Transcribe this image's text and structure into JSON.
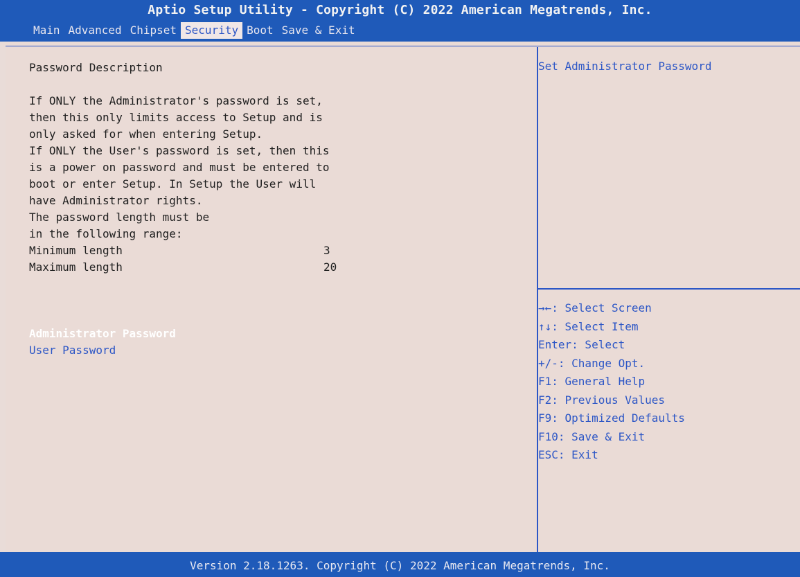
{
  "header": {
    "title": "Aptio Setup Utility - Copyright (C) 2022 American Megatrends, Inc.",
    "tabs": [
      "Main",
      "Advanced",
      "Chipset",
      "Security",
      "Boot",
      "Save & Exit"
    ],
    "active_tab": "Security"
  },
  "left": {
    "heading": "Password Description",
    "paragraph": [
      "If ONLY the Administrator's password is set,",
      "then this only limits access to Setup and is",
      "only asked for when entering Setup.",
      "If ONLY the User's password is set, then this",
      "is a power on password and must be entered to",
      "boot or enter Setup. In Setup the User will",
      "have Administrator rights.",
      "The password length must be",
      "in the following range:"
    ],
    "min_label": "Minimum length",
    "min_value": "3",
    "max_label": "Maximum length",
    "max_value": "20",
    "menu": [
      {
        "label": "Administrator Password"
      },
      {
        "label": "User Password"
      }
    ]
  },
  "right": {
    "help": "Set Administrator Password",
    "keys": [
      "→←: Select Screen",
      "↑↓: Select Item",
      "Enter: Select",
      "+/-: Change Opt.",
      "F1: General Help",
      "F2: Previous Values",
      "F9: Optimized Defaults",
      "F10: Save & Exit",
      "ESC: Exit"
    ]
  },
  "footer": {
    "version": "Version 2.18.1263. Copyright (C) 2022 American Megatrends, Inc."
  },
  "colors": {
    "bar_blue": "#1f5ab9",
    "text_blue": "#2c56c6",
    "background": "#e9dcd8",
    "selected_text": "#ffffff"
  }
}
